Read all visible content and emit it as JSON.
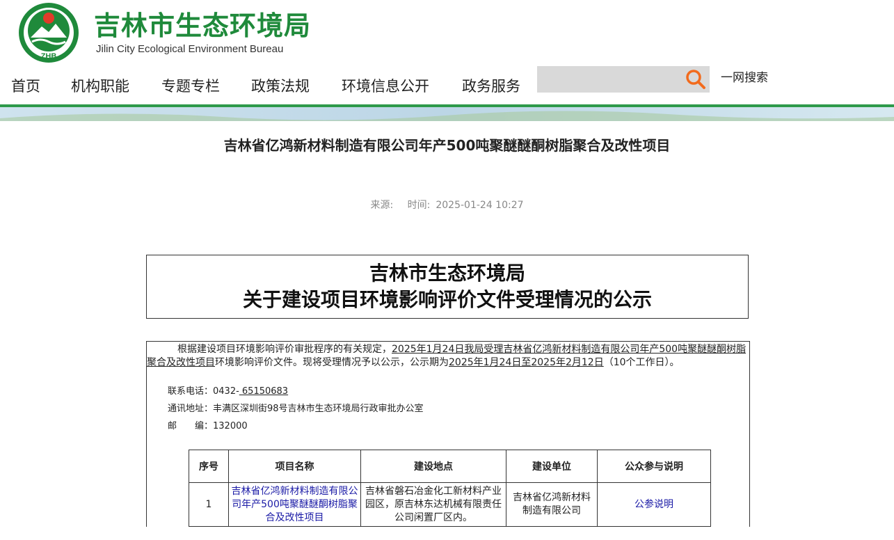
{
  "header": {
    "logo_text": "ZHB",
    "title": "吉林市生态环境局",
    "subtitle": "Jilin City Ecological Environment Bureau"
  },
  "nav": {
    "items": [
      "首页",
      "机构职能",
      "专题专栏",
      "政策法规",
      "环境信息公开",
      "政务服务"
    ],
    "search_placeholder": "",
    "search_label": "一网搜索"
  },
  "article": {
    "title": "吉林省亿鸿新材料制造有限公司年产500吨聚醚醚酮树脂聚合及改性项目",
    "source_label": "来源:",
    "time_label": "时间:",
    "time_value": "2025-01-24 10:27"
  },
  "notice": {
    "line1": "吉林市生态环境局",
    "line2": "关于建设项目环境影响评价文件受理情况的公示"
  },
  "body": {
    "p_part1": "根据建设项目环境影响评价审批程序的有关规定，",
    "p_part2": "2025年1月24日我局受理吉林省亿鸿新材料制造有限公司年产500吨聚醚醚酮树脂聚合及改性项目",
    "p_part3": "环境影响评价文件。现将受理情况予以公示，公示期为",
    "p_part4": "2025年1月24日至2025年2月12日",
    "p_part5": "（10个工作日）。",
    "phone_label": "联系电话：0432-",
    "phone_value": " 65150683",
    "address": "通讯地址：丰满区深圳街98号吉林市生态环境局行政审批办公室",
    "postcode_label": "邮　　编：",
    "postcode_value": "132000"
  },
  "table": {
    "headers": [
      "序号",
      "项目名称",
      "建设地点",
      "建设单位",
      "公众参与说明"
    ],
    "rows": [
      {
        "no": "1",
        "name": "吉林省亿鸿新材料制造有限公司年产500吨聚醚醚酮树脂聚合及改性项目",
        "location": "吉林省磐石冶金化工新材料产业园区，原吉林东达机械有限责任公司闲置厂区内。",
        "unit": "吉林省亿鸿新材料制造有限公司",
        "participation": "公参说明"
      }
    ]
  },
  "colors": {
    "brand_green": "#1f8a3b",
    "link_blue": "#1a1aa6",
    "search_orange": "#f26b1d"
  }
}
